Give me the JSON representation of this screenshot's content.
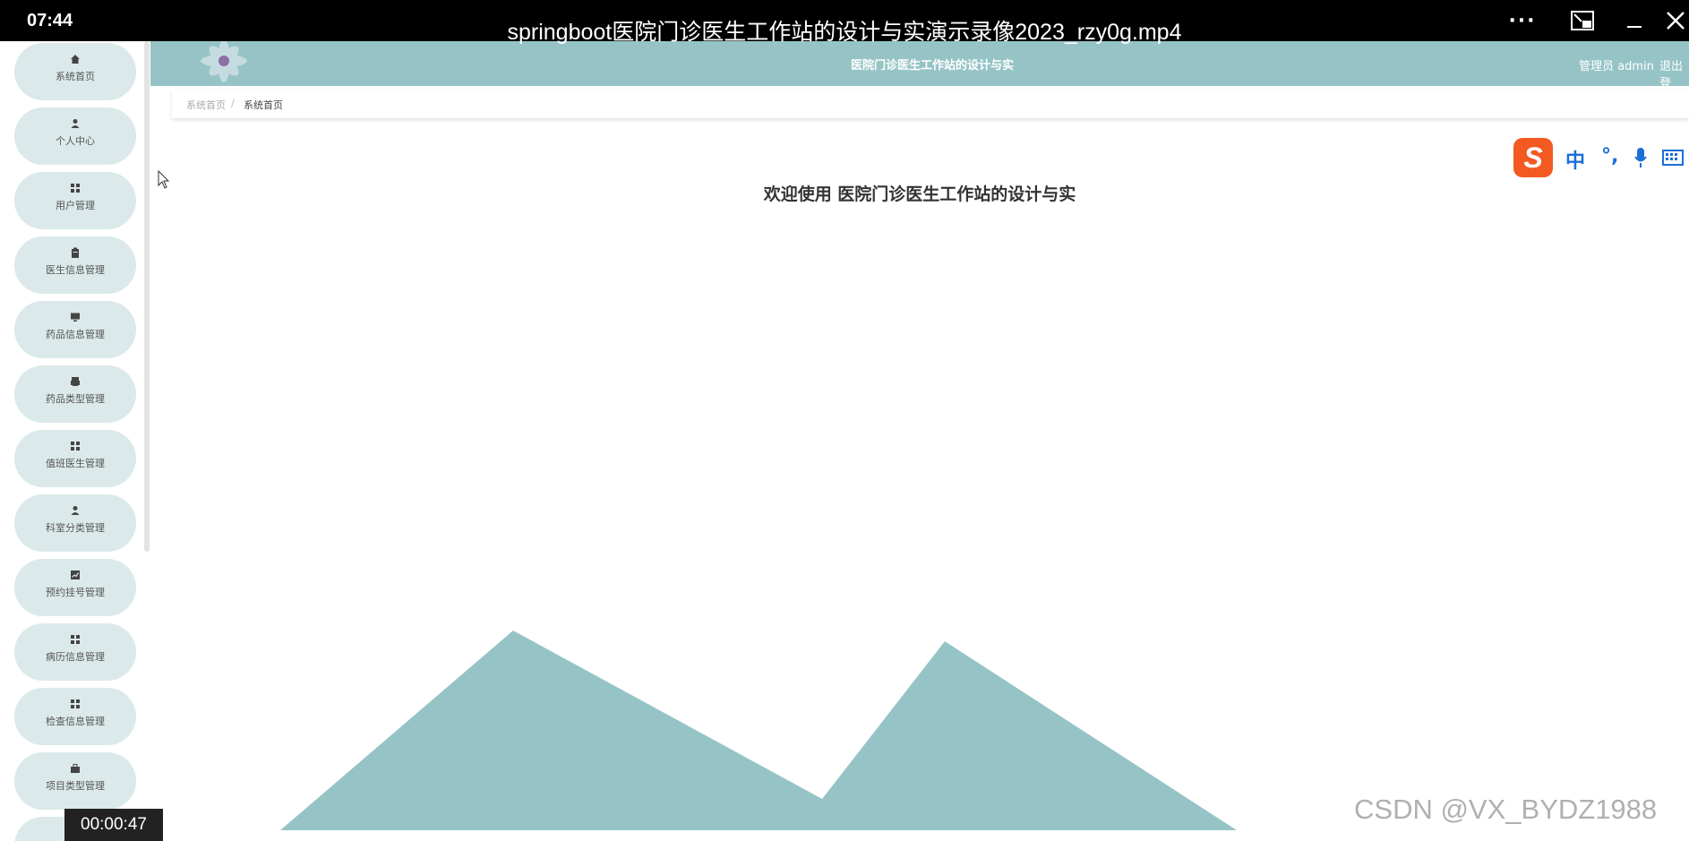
{
  "player": {
    "clock": "07:44",
    "title": "springboot医院门诊医生工作站的设计与实演示录像2023_rzy0g.mp4",
    "more_label": "···",
    "timestamp": "00:00:47",
    "watermark": "CSDN @VX_BYDZ1988"
  },
  "sidebar": {
    "items": [
      {
        "label": "系统首页",
        "icon": "home-icon"
      },
      {
        "label": "个人中心",
        "icon": "user-icon"
      },
      {
        "label": "用户管理",
        "icon": "grid-icon"
      },
      {
        "label": "医生信息管理",
        "icon": "clipboard-icon"
      },
      {
        "label": "药品信息管理",
        "icon": "monitor-icon"
      },
      {
        "label": "药品类型管理",
        "icon": "printer-icon"
      },
      {
        "label": "值班医生管理",
        "icon": "grid-icon"
      },
      {
        "label": "科室分类管理",
        "icon": "user-icon"
      },
      {
        "label": "预约挂号管理",
        "icon": "chart-icon"
      },
      {
        "label": "病历信息管理",
        "icon": "grid-icon"
      },
      {
        "label": "检查信息管理",
        "icon": "grid-icon"
      },
      {
        "label": "项目类型管理",
        "icon": "briefcase-icon"
      }
    ]
  },
  "header": {
    "title": "医院门诊医生工作站的设计与实",
    "user": "管理员 admin",
    "logout": "退出登"
  },
  "breadcrumb": {
    "root": "系统首页",
    "separator": "/",
    "current": "系统首页"
  },
  "main": {
    "welcome": "欢迎使用 医院门诊医生工作站的设计与实"
  },
  "ime": {
    "logo": "S",
    "mode": "中",
    "punct": "°,",
    "mic": "mic",
    "keyboard": "keyboard"
  },
  "colors": {
    "accent": "#96c4c6",
    "sidebar_item_bg": "#dbe9ea",
    "ime_logo": "#f25a22"
  }
}
